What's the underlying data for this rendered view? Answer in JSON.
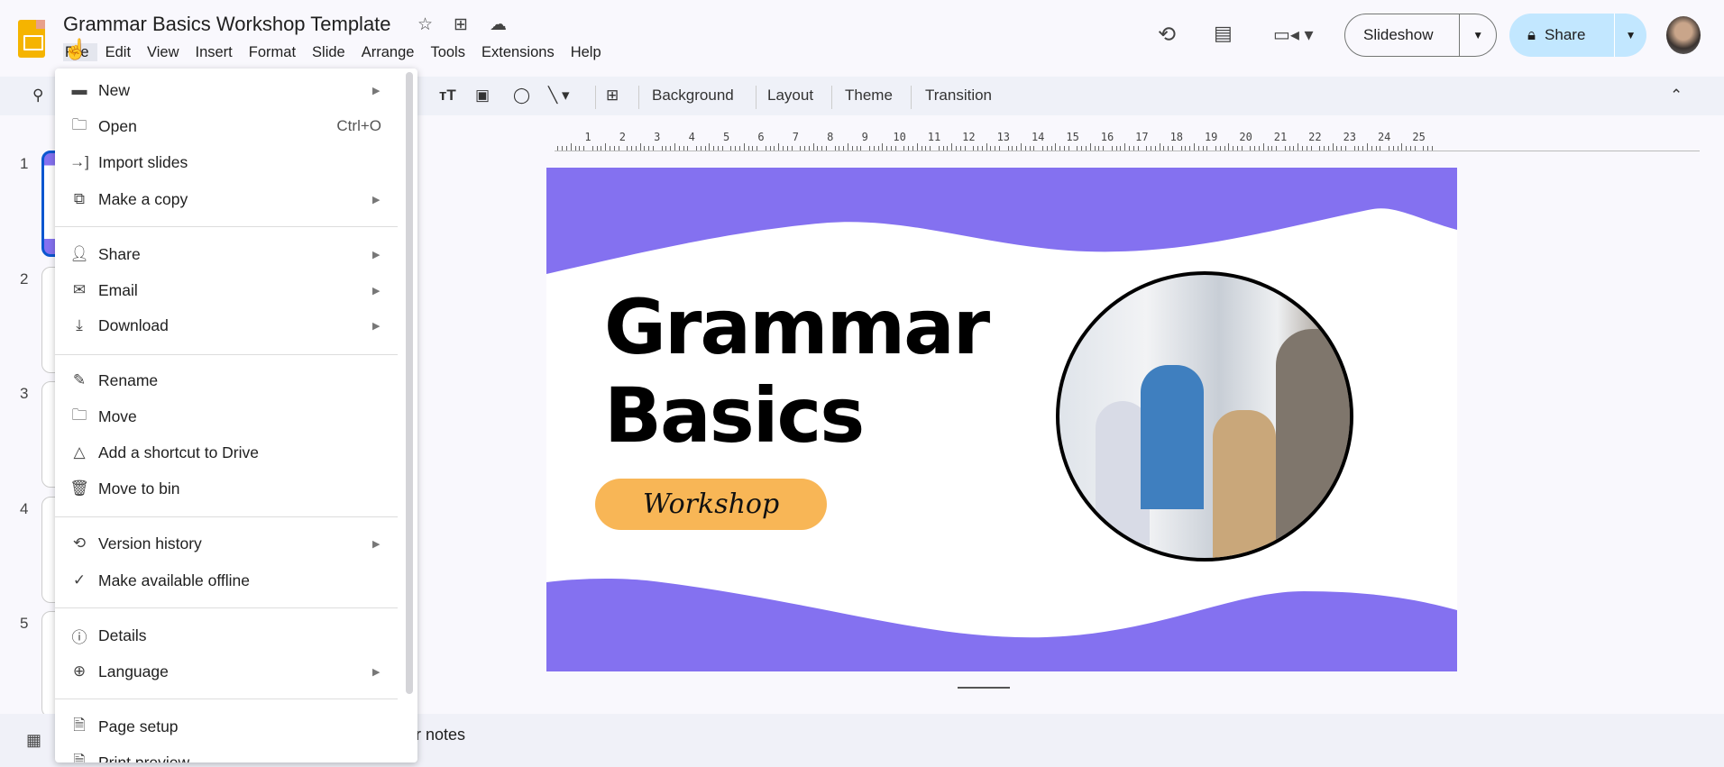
{
  "app": {
    "title": "Grammar Basics Workshop Template"
  },
  "menubar": [
    "File",
    "Edit",
    "View",
    "Insert",
    "Format",
    "Slide",
    "Arrange",
    "Tools",
    "Extensions",
    "Help"
  ],
  "header": {
    "slideshow_label": "Slideshow",
    "share_label": "Share",
    "share_color": "#c2e7ff"
  },
  "toolbar": {
    "background": "Background",
    "layout": "Layout",
    "theme": "Theme",
    "transition": "Transition"
  },
  "ruler": [
    "1",
    "2",
    "3",
    "4",
    "5",
    "6",
    "7",
    "8",
    "9",
    "10",
    "11",
    "12",
    "13",
    "14",
    "15",
    "16",
    "17",
    "18",
    "19",
    "20",
    "21",
    "22",
    "23",
    "24",
    "25"
  ],
  "filmstrip": [
    "1",
    "2",
    "3",
    "4",
    "5"
  ],
  "file_menu": [
    {
      "label": "New",
      "icon": "new-slides-icon",
      "submenu": true
    },
    {
      "label": "Open",
      "icon": "folder-icon",
      "shortcut": "Ctrl+O"
    },
    {
      "label": "Import slides",
      "icon": "import-icon"
    },
    {
      "label": "Make a copy",
      "icon": "copy-icon",
      "submenu": true
    },
    {
      "label": "Share",
      "icon": "person-add-icon",
      "submenu": true
    },
    {
      "label": "Email",
      "icon": "mail-icon",
      "submenu": true
    },
    {
      "label": "Download",
      "icon": "download-icon",
      "submenu": true
    },
    {
      "label": "Rename",
      "icon": "rename-icon"
    },
    {
      "label": "Move",
      "icon": "move-folder-icon"
    },
    {
      "label": "Add a shortcut to Drive",
      "icon": "drive-shortcut-icon"
    },
    {
      "label": "Move to bin",
      "icon": "trash-icon"
    },
    {
      "label": "Version history",
      "icon": "history-icon",
      "submenu": true
    },
    {
      "label": "Make available offline",
      "icon": "offline-icon"
    },
    {
      "label": "Details",
      "icon": "info-icon"
    },
    {
      "label": "Language",
      "icon": "globe-icon",
      "submenu": true
    },
    {
      "label": "Page setup",
      "icon": "page-icon"
    },
    {
      "label": "Print preview",
      "icon": "print-preview-icon"
    }
  ],
  "slide": {
    "title_line1": "Grammar",
    "title_line2": "Basics",
    "pill": "Workshop",
    "accent": "#8471f0",
    "pill_color": "#f8b656"
  },
  "notes": {
    "label": "er notes"
  }
}
